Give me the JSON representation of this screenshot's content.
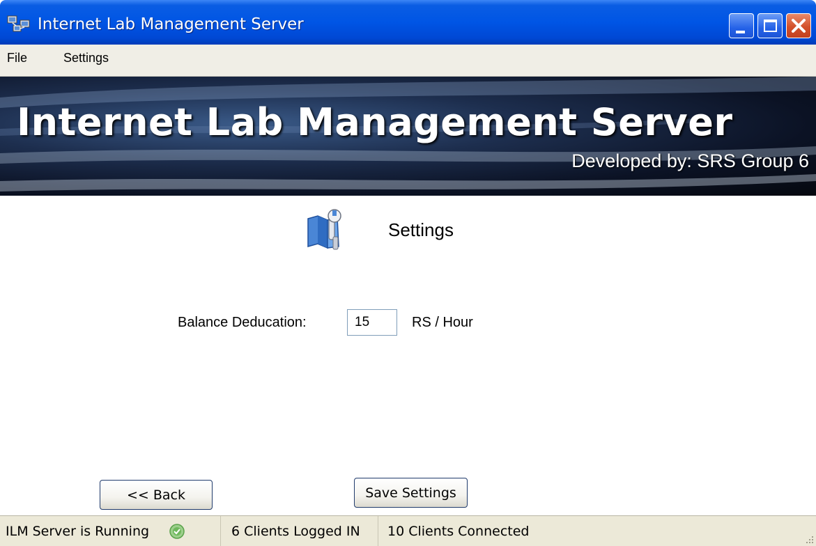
{
  "window": {
    "title": "Internet Lab Management Server"
  },
  "menubar": {
    "items": [
      "File",
      "Settings"
    ]
  },
  "banner": {
    "title": "Internet Lab Management Server",
    "subtitle": "Developed by: SRS Group 6"
  },
  "page": {
    "heading": "Settings",
    "icon": "settings-tools-icon"
  },
  "form": {
    "balance_label": "Balance Deducation:",
    "balance_value": "15",
    "balance_unit": "RS / Hour"
  },
  "buttons": {
    "back": "<< Back",
    "save": "Save Settings"
  },
  "status": {
    "server": "ILM Server is Running",
    "logged_in": "6 Clients Logged IN",
    "connected": "10 Clients Connected"
  },
  "colors": {
    "titlebar": "#0055e5",
    "status_ok": "#5aa24a"
  }
}
